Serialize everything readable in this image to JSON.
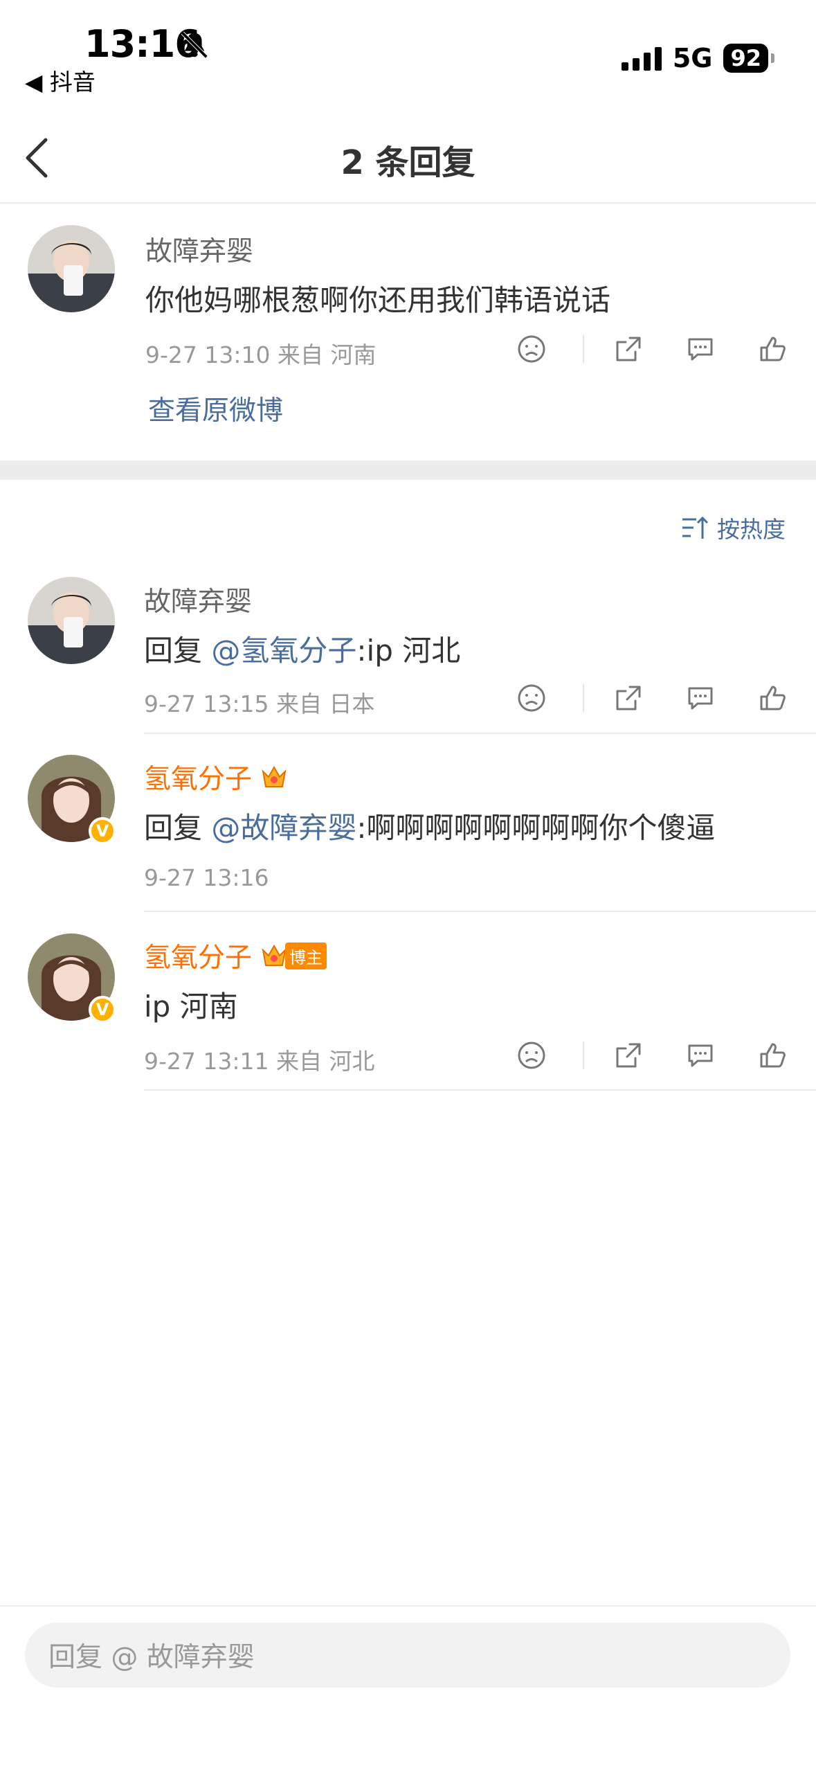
{
  "status_bar": {
    "time": "13:16",
    "back_app": "◀ 抖音",
    "network": "5G",
    "battery": "92"
  },
  "header": {
    "title": "2 条回复"
  },
  "main_comment": {
    "username": "故障弃婴",
    "text": "你他妈哪根葱啊你还用我们韩语说话",
    "meta": "9-27 13:10  来自 河南",
    "view_original": "查看原微博"
  },
  "sort": {
    "label": "按热度"
  },
  "replies": [
    {
      "username": "故障弃婴",
      "prefix": "回复 ",
      "mention": "@氢氧分子",
      "text": ":ip 河北",
      "meta": "9-27 13:15  来自 日本"
    },
    {
      "username": "氢氧分子",
      "prefix": "回复 ",
      "mention": "@故障弃婴",
      "text": ":啊啊啊啊啊啊啊啊你个傻逼",
      "meta": "9-27 13:16"
    },
    {
      "username": "氢氧分子",
      "badge_label": "博主",
      "text": "ip 河南",
      "meta": "9-27 13:11  来自 河北"
    }
  ],
  "reply_box": {
    "placeholder": "回复 @ 故障弃婴"
  },
  "colors": {
    "link": "#4a6d9e",
    "vip_name": "#ff7000",
    "divider": "#ececec"
  }
}
